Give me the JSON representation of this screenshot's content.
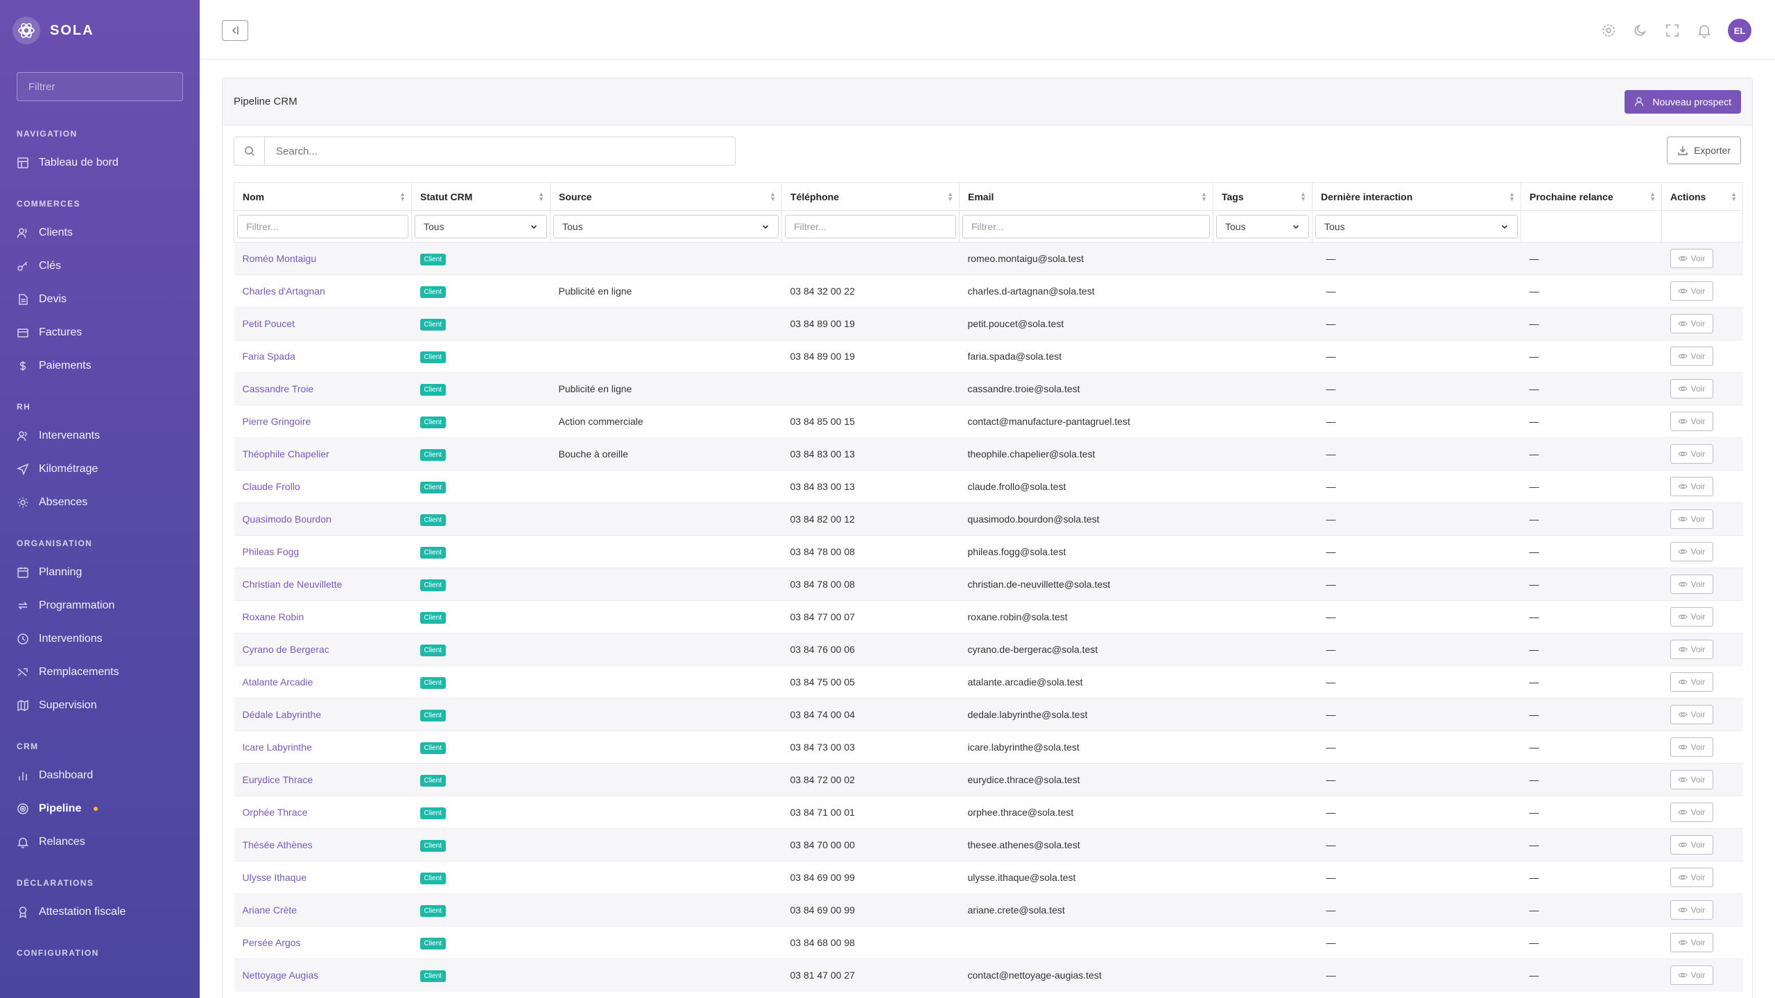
{
  "sidebar": {
    "brand": "SOLA",
    "filter_placeholder": "Filtrer",
    "sections": [
      {
        "title": "NAVIGATION",
        "items": [
          {
            "label": "Tableau de bord",
            "icon": "dashboard-icon"
          }
        ]
      },
      {
        "title": "COMMERCES",
        "items": [
          {
            "label": "Clients",
            "icon": "users-icon"
          },
          {
            "label": "Clés",
            "icon": "key-icon"
          },
          {
            "label": "Devis",
            "icon": "document-icon"
          },
          {
            "label": "Factures",
            "icon": "invoice-icon"
          },
          {
            "label": "Paiements",
            "icon": "dollar-icon"
          }
        ]
      },
      {
        "title": "RH",
        "items": [
          {
            "label": "Intervenants",
            "icon": "users-icon"
          },
          {
            "label": "Kilométrage",
            "icon": "send-icon"
          },
          {
            "label": "Absences",
            "icon": "sun-icon"
          }
        ]
      },
      {
        "title": "ORGANISATION",
        "items": [
          {
            "label": "Planning",
            "icon": "calendar-icon"
          },
          {
            "label": "Programmation",
            "icon": "repeat-icon"
          },
          {
            "label": "Interventions",
            "icon": "clock-icon"
          },
          {
            "label": "Remplacements",
            "icon": "shuffle-icon"
          },
          {
            "label": "Supervision",
            "icon": "map-icon"
          }
        ]
      },
      {
        "title": "CRM",
        "items": [
          {
            "label": "Dashboard",
            "icon": "bar-chart-icon"
          },
          {
            "label": "Pipeline",
            "icon": "target-icon",
            "active": true
          },
          {
            "label": "Relances",
            "icon": "bell-icon"
          }
        ]
      },
      {
        "title": "DÉCLARATIONS",
        "items": [
          {
            "label": "Attestation fiscale",
            "icon": "award-icon"
          }
        ]
      },
      {
        "title": "CONFIGURATION",
        "items": []
      }
    ]
  },
  "topbar": {
    "avatar_initials": "EL",
    "icons": [
      "settings-icon",
      "moon-icon",
      "fullscreen-icon",
      "bell-icon"
    ]
  },
  "card": {
    "title": "Pipeline CRM",
    "new_button": "Nouveau prospect",
    "search_placeholder": "Search...",
    "export_button": "Exporter"
  },
  "table": {
    "columns": [
      "Nom",
      "Statut CRM",
      "Source",
      "Téléphone",
      "Email",
      "Tags",
      "Dernière interaction",
      "Prochaine relance",
      "Actions"
    ],
    "filters": {
      "text_placeholder": "Filtrer...",
      "select_value": "Tous"
    },
    "action_label": "Voir",
    "rows": [
      {
        "name": "Roméo Montaigu",
        "status": "Client",
        "source": "",
        "phone": "",
        "email": "romeo.montaigu@sola.test",
        "last": "—",
        "next": "—"
      },
      {
        "name": "Charles d'Artagnan",
        "status": "Client",
        "source": "Publicité en ligne",
        "phone": "03 84 32 00 22",
        "email": "charles.d-artagnan@sola.test",
        "last": "—",
        "next": "—"
      },
      {
        "name": "Petit Poucet",
        "status": "Client",
        "source": "",
        "phone": "03 84 89 00 19",
        "email": "petit.poucet@sola.test",
        "last": "—",
        "next": "—"
      },
      {
        "name": "Faria Spada",
        "status": "Client",
        "source": "",
        "phone": "03 84 89 00 19",
        "email": "faria.spada@sola.test",
        "last": "—",
        "next": "—"
      },
      {
        "name": "Cassandre Troie",
        "status": "Client",
        "source": "Publicité en ligne",
        "phone": "",
        "email": "cassandre.troie@sola.test",
        "last": "—",
        "next": "—"
      },
      {
        "name": "Pierre Gringoire",
        "status": "Client",
        "source": "Action commerciale",
        "phone": "03 84 85 00 15",
        "email": "contact@manufacture-pantagruel.test",
        "last": "—",
        "next": "—"
      },
      {
        "name": "Théophile Chapelier",
        "status": "Client",
        "source": "Bouche à oreille",
        "phone": "03 84 83 00 13",
        "email": "theophile.chapelier@sola.test",
        "last": "—",
        "next": "—"
      },
      {
        "name": "Claude Frollo",
        "status": "Client",
        "source": "",
        "phone": "03 84 83 00 13",
        "email": "claude.frollo@sola.test",
        "last": "—",
        "next": "—"
      },
      {
        "name": "Quasimodo Bourdon",
        "status": "Client",
        "source": "",
        "phone": "03 84 82 00 12",
        "email": "quasimodo.bourdon@sola.test",
        "last": "—",
        "next": "—"
      },
      {
        "name": "Phileas Fogg",
        "status": "Client",
        "source": "",
        "phone": "03 84 78 00 08",
        "email": "phileas.fogg@sola.test",
        "last": "—",
        "next": "—"
      },
      {
        "name": "Christian de Neuvillette",
        "status": "Client",
        "source": "",
        "phone": "03 84 78 00 08",
        "email": "christian.de-neuvillette@sola.test",
        "last": "—",
        "next": "—"
      },
      {
        "name": "Roxane Robin",
        "status": "Client",
        "source": "",
        "phone": "03 84 77 00 07",
        "email": "roxane.robin@sola.test",
        "last": "—",
        "next": "—"
      },
      {
        "name": "Cyrano de Bergerac",
        "status": "Client",
        "source": "",
        "phone": "03 84 76 00 06",
        "email": "cyrano.de-bergerac@sola.test",
        "last": "—",
        "next": "—"
      },
      {
        "name": "Atalante Arcadie",
        "status": "Client",
        "source": "",
        "phone": "03 84 75 00 05",
        "email": "atalante.arcadie@sola.test",
        "last": "—",
        "next": "—"
      },
      {
        "name": "Dédale Labyrinthe",
        "status": "Client",
        "source": "",
        "phone": "03 84 74 00 04",
        "email": "dedale.labyrinthe@sola.test",
        "last": "—",
        "next": "—"
      },
      {
        "name": "Icare Labyrinthe",
        "status": "Client",
        "source": "",
        "phone": "03 84 73 00 03",
        "email": "icare.labyrinthe@sola.test",
        "last": "—",
        "next": "—"
      },
      {
        "name": "Eurydice Thrace",
        "status": "Client",
        "source": "",
        "phone": "03 84 72 00 02",
        "email": "eurydice.thrace@sola.test",
        "last": "—",
        "next": "—"
      },
      {
        "name": "Orphée Thrace",
        "status": "Client",
        "source": "",
        "phone": "03 84 71 00 01",
        "email": "orphee.thrace@sola.test",
        "last": "—",
        "next": "—"
      },
      {
        "name": "Thésée Athènes",
        "status": "Client",
        "source": "",
        "phone": "03 84 70 00 00",
        "email": "thesee.athenes@sola.test",
        "last": "—",
        "next": "—"
      },
      {
        "name": "Ulysse Ithaque",
        "status": "Client",
        "source": "",
        "phone": "03 84 69 00 99",
        "email": "ulysse.ithaque@sola.test",
        "last": "—",
        "next": "—"
      },
      {
        "name": "Ariane Crète",
        "status": "Client",
        "source": "",
        "phone": "03 84 69 00 99",
        "email": "ariane.crete@sola.test",
        "last": "—",
        "next": "—"
      },
      {
        "name": "Persée Argos",
        "status": "Client",
        "source": "",
        "phone": "03 84 68 00 98",
        "email": "",
        "last": "—",
        "next": "—"
      },
      {
        "name": "Nettoyage Augias",
        "status": "Client",
        "source": "",
        "phone": "03 81 47 00 27",
        "email": "contact@nettoyage-augias.test",
        "last": "—",
        "next": "—"
      }
    ]
  }
}
